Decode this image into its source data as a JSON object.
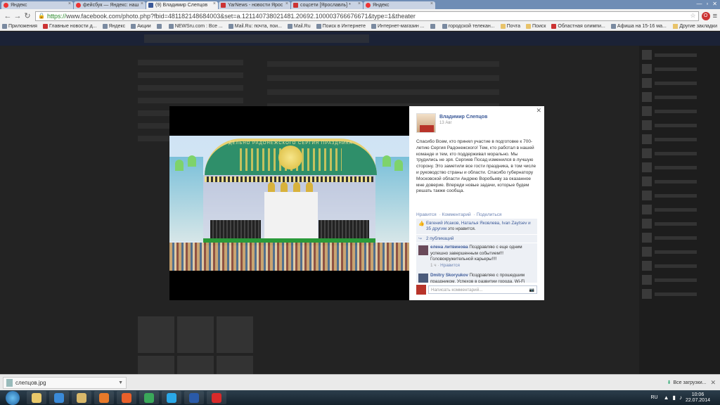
{
  "browser": {
    "tabs": [
      {
        "title": "Яндекс",
        "icon": "yandex-icon"
      },
      {
        "title": "фейсбук — Яндекс: наш",
        "icon": "yandex-icon"
      },
      {
        "title": "(9) Владимир Слепцов",
        "icon": "facebook-icon",
        "active": true
      },
      {
        "title": "YarNews - новости Ярос",
        "icon": "yarnews-icon"
      },
      {
        "title": "соцсети [Ярославль] *",
        "icon": "page-icon"
      },
      {
        "title": "Яндекс",
        "icon": "yandex-icon"
      }
    ],
    "url_scheme": "https://",
    "url_rest": "www.facebook.com/photo.php?fbid=481182148684003&set=a.121140738021481.20692.100003766676671&type=1&theater",
    "bookmarks": [
      {
        "label": "Приложения",
        "icon": "apps-icon"
      },
      {
        "label": "Главные новости д...",
        "icon": "news-icon"
      },
      {
        "label": "Яндекс",
        "icon": "yandex-icon"
      },
      {
        "label": "Акции",
        "icon": "page-icon"
      },
      {
        "label": "",
        "icon": "page-icon"
      },
      {
        "label": "NEWSru.com : Все ...",
        "icon": "page-icon"
      },
      {
        "label": "Mail.Ru: почта, пои...",
        "icon": "mail-icon"
      },
      {
        "label": "Mail.Ru",
        "icon": "mail-icon"
      },
      {
        "label": "Поиск в Интернете",
        "icon": "search-icon"
      },
      {
        "label": "Интернет-магазин ...",
        "icon": "page-icon"
      },
      {
        "label": "",
        "icon": "page-icon"
      },
      {
        "label": "городской телекан...",
        "icon": "page-icon"
      },
      {
        "label": "Почта",
        "icon": "folder-icon"
      },
      {
        "label": "Поиск",
        "icon": "folder-icon"
      },
      {
        "label": "Областная олимпи...",
        "icon": "gmail-icon"
      },
      {
        "label": "Афиша на 15-16 ма...",
        "icon": "page-icon"
      }
    ],
    "other_bookmarks": "Другие закладки"
  },
  "post": {
    "author": "Владимир Слепцов",
    "date": "13 Авг",
    "text": "Спасибо Всем, кто принял участие в подготовке к 700-летию Сергия Радонежского! Тем, кто работал в нашей команде и тем, кто поддерживал морально. Мы трудились не зря. Сергиев Посад изменился в лучшую сторону. Это заметили все гости праздника, в том числе и руководство страны и области. Спасибо губернатору Московской области Андрею Воробьеву за оказанное мне доверие. Впереди новые задачи, которые будем решать также сообща.",
    "actions": {
      "like": "Нравится",
      "comment": "Комментарий",
      "share": "Поделиться"
    },
    "likes_names": "Евгений Исаков, Наталья Яковлева, Ivan Zaytsev и 35 другим",
    "likes_suffix": " это нравится.",
    "shares": "2 публикаций",
    "comments": [
      {
        "name": "елена литвинова",
        "text": "Поздравляю с еще одним успешно завершенным событием!!! Головокружительной карьеры!!!!",
        "meta_time": "1 ч",
        "meta_like": "Нравится"
      },
      {
        "name": "Dmitry Skoryukov",
        "text": "Поздравляю с прошедшим праздником. Успехов в развитии города. Wi-Fi"
      }
    ],
    "compose_placeholder": "Написать комментарий..."
  },
  "photo": {
    "arch_text": "ДЕЛЬНО РАДОНЕЖСКОГО СЕРГИЯ ПРАЗДНИКА"
  },
  "downloads": {
    "file": "слепцов.jpg",
    "all": "Все загрузки..."
  },
  "taskbar": {
    "apps": [
      {
        "name": "explorer-app",
        "color": "#e8c86a"
      },
      {
        "name": "ie-app",
        "color": "#3a8ad8"
      },
      {
        "name": "library-app",
        "color": "#d8b86a"
      },
      {
        "name": "media-player-app",
        "color": "#e87a2a"
      },
      {
        "name": "firefox-app",
        "color": "#e8602a"
      },
      {
        "name": "chrome-app",
        "color": "#3aa85a"
      },
      {
        "name": "skype-app",
        "color": "#2aa8e8"
      },
      {
        "name": "word-app",
        "color": "#2a5aa8"
      },
      {
        "name": "opera-app",
        "color": "#d82a2a"
      }
    ],
    "lang": "RU",
    "time": "10:06",
    "date": "22.07.2014"
  }
}
